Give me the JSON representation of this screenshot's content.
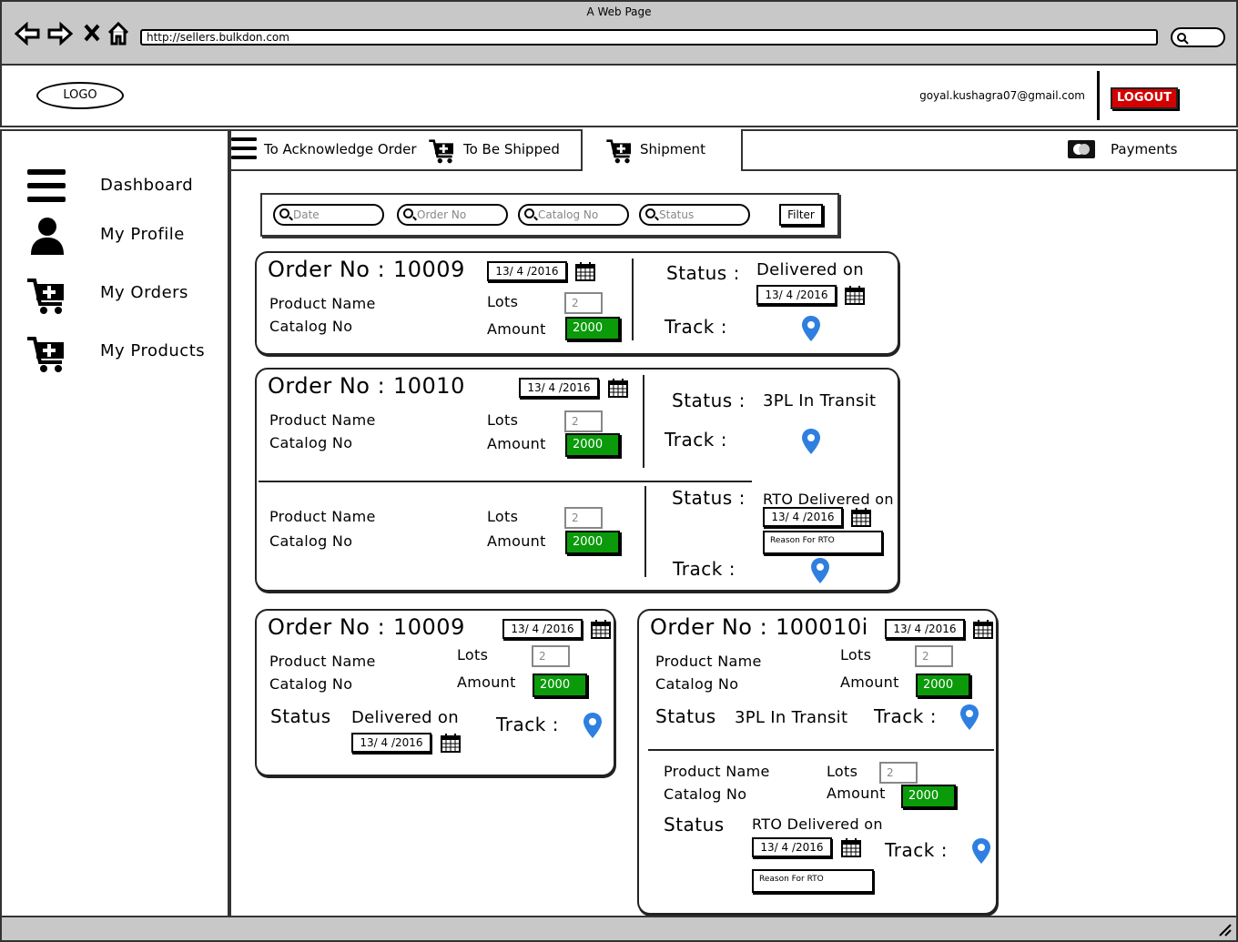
{
  "window": {
    "title": "A Web Page",
    "url": "http://sellers.bulkdon.com"
  },
  "header": {
    "logo": "LOGO",
    "email": "goyal.kushagra07@gmail.com",
    "logout": "LOGOUT"
  },
  "sidebar": {
    "items": [
      {
        "label": "Dashboard",
        "icon": "menu-icon"
      },
      {
        "label": "My Profile",
        "icon": "user-icon"
      },
      {
        "label": "My Orders",
        "icon": "cart-add-icon"
      },
      {
        "label": "My Products",
        "icon": "cart-add-icon"
      }
    ]
  },
  "tabs": [
    {
      "label": "To Acknowledge Order",
      "icon": "menu-icon"
    },
    {
      "label": "To Be Shipped",
      "icon": "cart-add-icon"
    },
    {
      "label": "Shipment",
      "icon": "cart-add-icon",
      "active": true
    },
    {
      "label": "Payments",
      "icon": "card-icon"
    }
  ],
  "filters": {
    "date": "Date",
    "order_no": "Order No",
    "catalog_no": "Catalog No",
    "status": "Status",
    "button": "Filter"
  },
  "labels": {
    "order_no": "Order No :",
    "product_name": "Product Name",
    "catalog_no": "Catalog No",
    "lots": "Lots",
    "amount": "Amount",
    "status": "Status :",
    "status_plain": "Status",
    "track": "Track :",
    "reason": "Reason For RTO"
  },
  "orders": [
    {
      "order_no": "10009",
      "date": "13/ 4 /2016",
      "lots": "2",
      "amount": "2000",
      "status": "Delivered on",
      "status_date": "13/ 4 /2016"
    },
    {
      "order_no": "10010",
      "date": "13/ 4 /2016",
      "lots": "2",
      "amount": "2000",
      "status": "3PL In Transit",
      "sub": {
        "lots": "2",
        "amount": "2000",
        "status": "RTO Delivered on",
        "status_date": "13/ 4 /2016"
      }
    },
    {
      "order_no": "10009",
      "date": "13/ 4 /2016",
      "lots": "2",
      "amount": "2000",
      "status": "Delivered on",
      "status_date": "13/ 4 /2016"
    },
    {
      "order_no": "100010i",
      "date": "13/ 4 /2016",
      "lots": "2",
      "amount": "2000",
      "status": "3PL In Transit",
      "sub": {
        "lots": "2",
        "amount": "2000",
        "status": "RTO Delivered on",
        "status_date": "13/ 4 /2016"
      }
    }
  ],
  "colors": {
    "logout": "#d40000",
    "amount": "#0a9a0a",
    "pin": "#2f7fe0",
    "chrome": "#c8c8c8"
  }
}
